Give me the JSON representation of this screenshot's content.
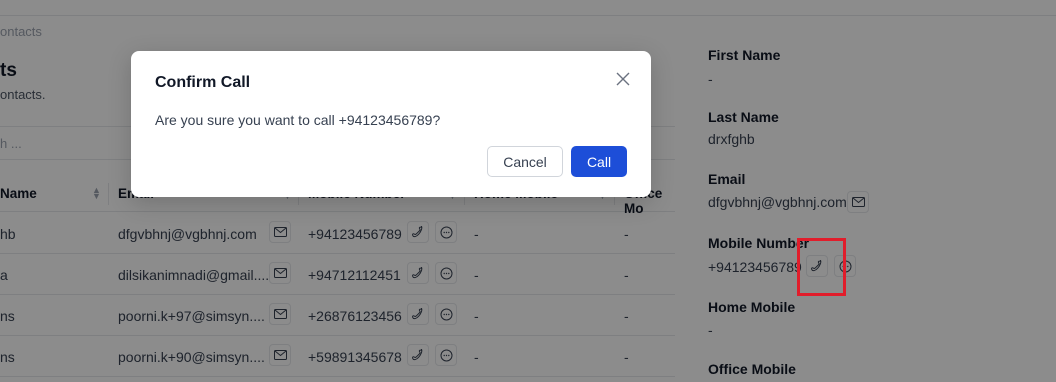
{
  "breadcrumb": "ontacts",
  "page": {
    "title": "ts",
    "subtitle": "ontacts.",
    "search_placeholder": "h ..."
  },
  "table": {
    "headers": {
      "name": "Name",
      "email": "Email",
      "mobile": "Mobile Number",
      "home": "Home Mobile",
      "office": "Office Mo"
    },
    "rows": [
      {
        "name": "hb",
        "email": "dfgvbhnj@vgbhnj.com",
        "mobile": "+94123456789",
        "home": "-",
        "office": "-"
      },
      {
        "name": "a",
        "email": "dilsikanimnadi@gmail....",
        "mobile": "+94712112451",
        "home": "-",
        "office": "-"
      },
      {
        "name": "ns",
        "email": "poorni.k+97@simsyn....",
        "mobile": "+26876123456",
        "home": "-",
        "office": "-"
      },
      {
        "name": "ns",
        "email": "poorni.k+90@simsyn....",
        "mobile": "+59891345678",
        "home": "-",
        "office": "-"
      }
    ]
  },
  "drawer": {
    "first_name_label": "First Name",
    "first_name_value": "-",
    "last_name_label": "Last Name",
    "last_name_value": "drxfghb",
    "email_label": "Email",
    "email_value": "dfgvbhnj@vgbhnj.com",
    "mobile_label": "Mobile Number",
    "mobile_value": "+94123456789",
    "home_label": "Home Mobile",
    "home_value": "-",
    "office_label": "Office Mobile"
  },
  "modal": {
    "title": "Confirm Call",
    "message": "Are you sure you want to call +94123456789?",
    "cancel_label": "Cancel",
    "call_label": "Call"
  },
  "icons": [
    "mail-icon",
    "phone-icon",
    "chat-icon",
    "close-icon",
    "sort-icon"
  ],
  "colors": {
    "primary": "#1d4ed8",
    "highlight": "#e11d2b",
    "overlay": "rgba(0,0,0,0.45)"
  }
}
